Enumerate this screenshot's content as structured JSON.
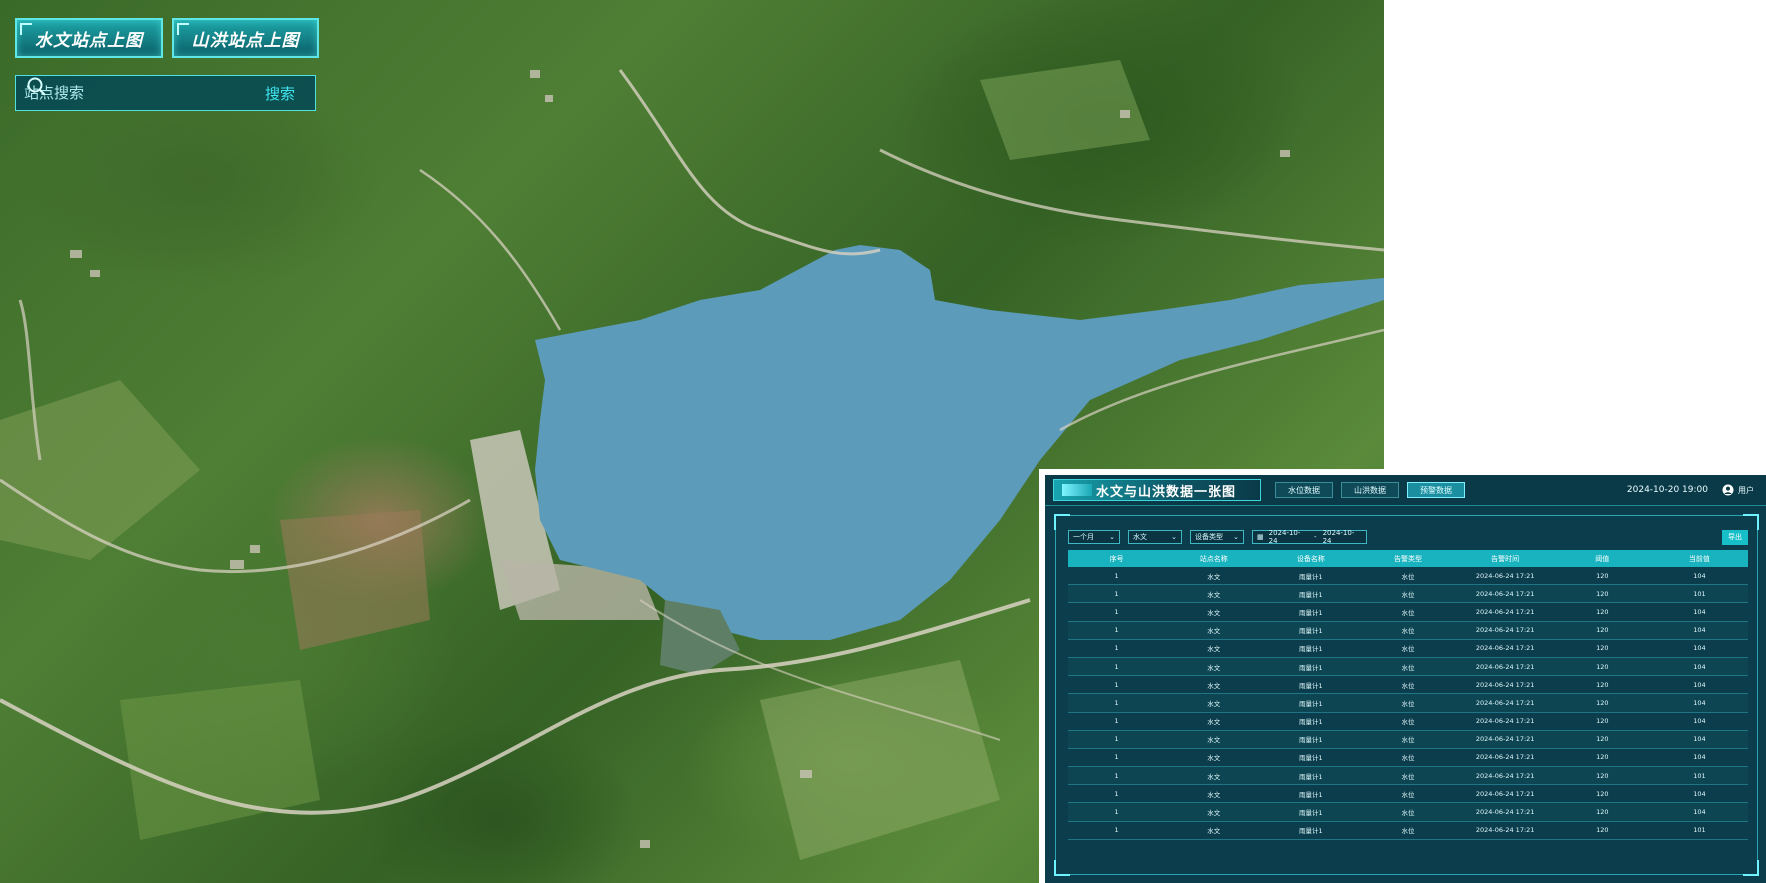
{
  "map_controls": {
    "hydro_button_label": "水文站点上图",
    "flood_button_label": "山洪站点上图",
    "search_placeholder": "站点搜索",
    "search_button_label": "搜索"
  },
  "panel": {
    "title": "水文与山洪数据一张图",
    "tabs": [
      {
        "label": "水位数据",
        "active": false
      },
      {
        "label": "山洪数据",
        "active": false
      },
      {
        "label": "预警数据",
        "active": true
      }
    ],
    "clock": "2024-10-20 19:00",
    "user_label": "用户",
    "filters": {
      "period": "一个月",
      "category": "水文",
      "device_type": "设备类型",
      "date_start": "2024-10-24",
      "date_end": "2024-10-24"
    },
    "export_label": "导出",
    "table": {
      "columns": [
        "序号",
        "站点名称",
        "设备名称",
        "告警类型",
        "告警时间",
        "阈值",
        "当前值"
      ],
      "rows": [
        [
          "1",
          "水文",
          "雨量计1",
          "水位",
          "2024-06-24 17:21",
          "120",
          "104"
        ],
        [
          "1",
          "水文",
          "雨量计1",
          "水位",
          "2024-06-24 17:21",
          "120",
          "101"
        ],
        [
          "1",
          "水文",
          "雨量计1",
          "水位",
          "2024-06-24 17:21",
          "120",
          "104"
        ],
        [
          "1",
          "水文",
          "雨量计1",
          "水位",
          "2024-06-24 17:21",
          "120",
          "104"
        ],
        [
          "1",
          "水文",
          "雨量计1",
          "水位",
          "2024-06-24 17:21",
          "120",
          "104"
        ],
        [
          "1",
          "水文",
          "雨量计1",
          "水位",
          "2024-06-24 17:21",
          "120",
          "104"
        ],
        [
          "1",
          "水文",
          "雨量计1",
          "水位",
          "2024-06-24 17:21",
          "120",
          "104"
        ],
        [
          "1",
          "水文",
          "雨量计1",
          "水位",
          "2024-06-24 17:21",
          "120",
          "104"
        ],
        [
          "1",
          "水文",
          "雨量计1",
          "水位",
          "2024-06-24 17:21",
          "120",
          "104"
        ],
        [
          "1",
          "水文",
          "雨量计1",
          "水位",
          "2024-06-24 17:21",
          "120",
          "104"
        ],
        [
          "1",
          "水文",
          "雨量计1",
          "水位",
          "2024-06-24 17:21",
          "120",
          "104"
        ],
        [
          "1",
          "水文",
          "雨量计1",
          "水位",
          "2024-06-24 17:21",
          "120",
          "101"
        ],
        [
          "1",
          "水文",
          "雨量计1",
          "水位",
          "2024-06-24 17:21",
          "120",
          "104"
        ],
        [
          "1",
          "水文",
          "雨量计1",
          "水位",
          "2024-06-24 17:21",
          "120",
          "104"
        ],
        [
          "1",
          "水文",
          "雨量计1",
          "水位",
          "2024-06-24 17:21",
          "120",
          "101"
        ]
      ]
    }
  }
}
